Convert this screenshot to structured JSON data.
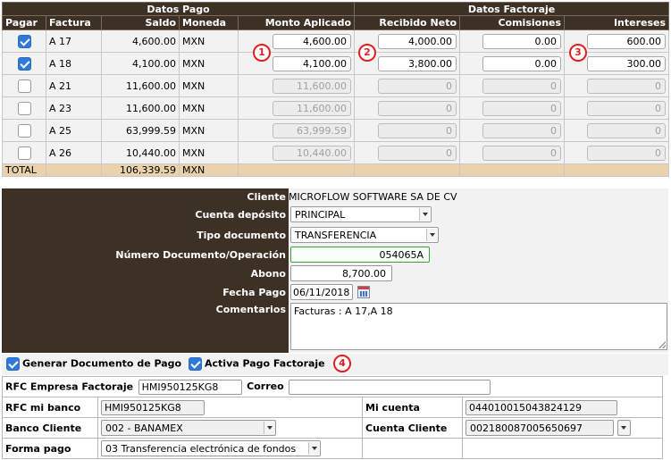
{
  "grid": {
    "group_headers": {
      "pago": "Datos Pago",
      "factoraje": "Datos Factoraje"
    },
    "columns": {
      "pagar": "Pagar",
      "factura": "Factura",
      "saldo": "Saldo",
      "moneda": "Moneda",
      "monto_aplicado": "Monto Aplicado",
      "recibido_neto": "Recibido Neto",
      "comisiones": "Comisiones",
      "intereses": "Intereses"
    },
    "rows": [
      {
        "checked": true,
        "factura": "A 17",
        "saldo": "4,600.00",
        "moneda": "MXN",
        "monto": "4,600.00",
        "recibido": "4,000.00",
        "comisiones": "0.00",
        "intereses": "600.00"
      },
      {
        "checked": true,
        "factura": "A 18",
        "saldo": "4,100.00",
        "moneda": "MXN",
        "monto": "4,100.00",
        "recibido": "3,800.00",
        "comisiones": "0.00",
        "intereses": "300.00"
      },
      {
        "checked": false,
        "factura": "A 21",
        "saldo": "11,600.00",
        "moneda": "MXN",
        "monto": "11,600.00",
        "recibido": "0",
        "comisiones": "0",
        "intereses": "0"
      },
      {
        "checked": false,
        "factura": "A 23",
        "saldo": "11,600.00",
        "moneda": "MXN",
        "monto": "11,600.00",
        "recibido": "0",
        "comisiones": "0",
        "intereses": "0"
      },
      {
        "checked": false,
        "factura": "A 25",
        "saldo": "63,999.59",
        "moneda": "MXN",
        "monto": "63,999.59",
        "recibido": "0",
        "comisiones": "0",
        "intereses": "0"
      },
      {
        "checked": false,
        "factura": "A 26",
        "saldo": "10,440.00",
        "moneda": "MXN",
        "monto": "10,440.00",
        "recibido": "0",
        "comisiones": "0",
        "intereses": "0"
      }
    ],
    "total": {
      "label": "TOTAL",
      "saldo": "106,339.59",
      "moneda": "MXN"
    }
  },
  "badges": {
    "b1": "1",
    "b2": "2",
    "b3": "3",
    "b4": "4"
  },
  "form": {
    "cliente_label": "Cliente",
    "cliente_value": "MICROFLOW SOFTWARE SA DE CV",
    "cuenta_label": "Cuenta depósito",
    "cuenta_value": "PRINCIPAL",
    "tipo_label": "Tipo documento",
    "tipo_value": "TRANSFERENCIA",
    "numdoc_label": "Número Documento/Operación",
    "numdoc_value": "054065A",
    "abono_label": "Abono",
    "abono_value": "8,700.00",
    "fecha_label": "Fecha Pago",
    "fecha_value": "06/11/2018",
    "comentarios_label": "Comentarios",
    "comentarios_value": "Facturas : A 17,A 18"
  },
  "options": {
    "generar_label": "Generar Documento de Pago",
    "generar_checked": true,
    "factoraje_label": "Activa Pago Factoraje",
    "factoraje_checked": true
  },
  "bank": {
    "rfc_emp_label": "RFC Empresa Factoraje",
    "rfc_emp_value": "HMI950125KG8",
    "correo_label": "Correo",
    "correo_value": "",
    "rfc_banco_label": "RFC mi banco",
    "rfc_banco_value": "HMI950125KG8",
    "mi_cuenta_label": "Mi cuenta",
    "mi_cuenta_value": "044010015043824129",
    "banco_cliente_label": "Banco Cliente",
    "banco_cliente_value": "002 - BANAMEX",
    "cuenta_cliente_label": "Cuenta Cliente",
    "cuenta_cliente_value": "002180087005650697",
    "forma_pago_label": "Forma pago",
    "forma_pago_value": "03 Transferencia electrónica de fondos"
  },
  "colors": {
    "header_bg": "#3d3126",
    "total_bg": "#e9d2ac",
    "checkbox_accent": "#2f7ad8",
    "badge_red": "#e02020"
  }
}
